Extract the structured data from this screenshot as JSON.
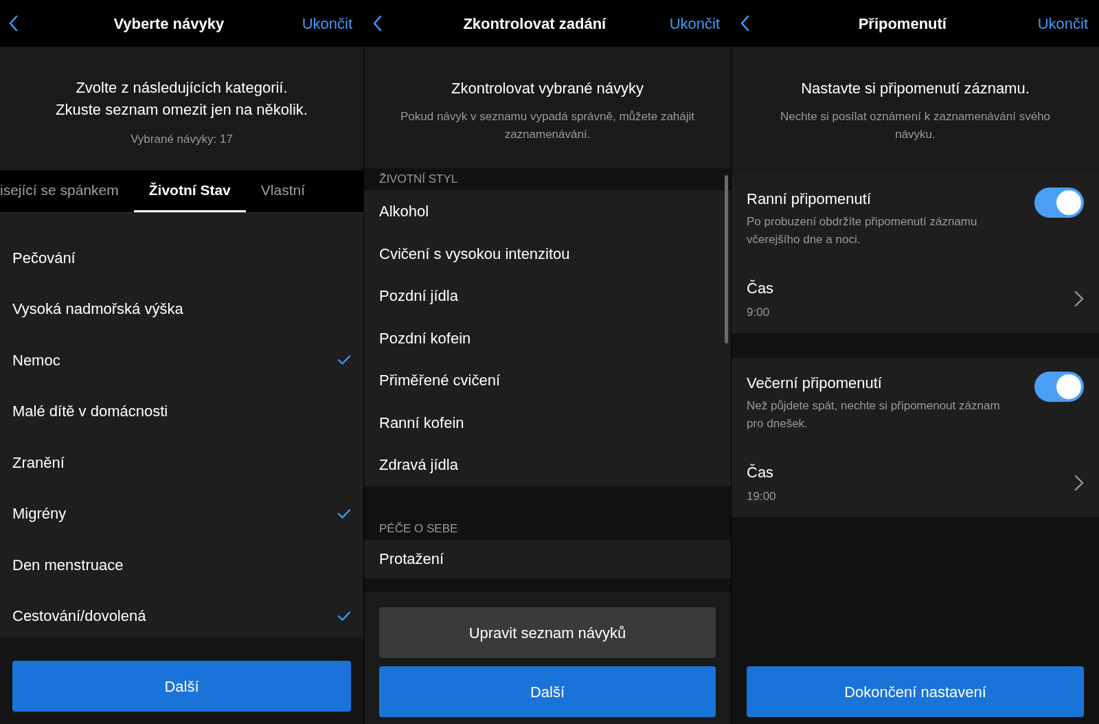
{
  "habit_picker": {
    "header": {
      "title": "Vyberte návyky",
      "action": "Ukončit"
    },
    "intro": {
      "title": "Zvolte z následujících kategorií.\nZkuste seznam omezit jen na několik.",
      "count": "Vybrané návyky: 17"
    },
    "tabs": [
      {
        "label": "isející se spánkem",
        "selected": false
      },
      {
        "label": "Životní Stav",
        "selected": true
      },
      {
        "label": "Vlastní",
        "selected": false
      }
    ],
    "items": [
      {
        "label": "Pečování",
        "checked": false
      },
      {
        "label": "Vysoká nadmořská výška",
        "checked": false
      },
      {
        "label": "Nemoc",
        "checked": true
      },
      {
        "label": "Malé dítě v domácnosti",
        "checked": false
      },
      {
        "label": "Zranění",
        "checked": false
      },
      {
        "label": "Migrény",
        "checked": true
      },
      {
        "label": "Den menstruace",
        "checked": false
      },
      {
        "label": "Cestování/dovolená",
        "checked": true
      }
    ],
    "button": "Další"
  },
  "review": {
    "header": {
      "title": "Zkontrolovat zadání",
      "action": "Ukončit"
    },
    "intro": {
      "title": "Zkontrolovat vybrané návyky",
      "description": "Pokud návyk v seznamu vypadá správně, můžete zahájit zaznamenávání."
    },
    "sections": [
      {
        "title": "ŽIVOTNÍ STYL",
        "items": [
          "Alkohol",
          "Cvičení s vysokou intenzitou",
          "Pozdní jídla",
          "Pozdní kofein",
          "Přiměřené cvičení",
          "Ranní kofein",
          "Zdravá jídla"
        ]
      },
      {
        "title": "PÉČE O SEBE",
        "items": [
          "Protažení"
        ]
      }
    ],
    "secondary_button": "Upravit seznam návyků",
    "button": "Další"
  },
  "reminders": {
    "header": {
      "title": "Připomenutí",
      "action": "Ukončit"
    },
    "intro": {
      "title": "Nastavte si připomenutí záznamu.",
      "description": "Nechte si posílat oznámení k zaznamenávání svého návyku."
    },
    "groups": [
      {
        "title": "Ranní připomenutí",
        "description": "Po probuzení obdržíte připomenutí záznamu včerejšího dne a noci.",
        "on": true,
        "time_label": "Čas",
        "time": "9:00"
      },
      {
        "title": "Večerní připomenutí",
        "description": "Než půjdete spát, nechte si připomenout záznam pro dnešek.",
        "on": true,
        "time_label": "Čas",
        "time": "19:00"
      }
    ],
    "button": "Dokončení nastavení"
  }
}
